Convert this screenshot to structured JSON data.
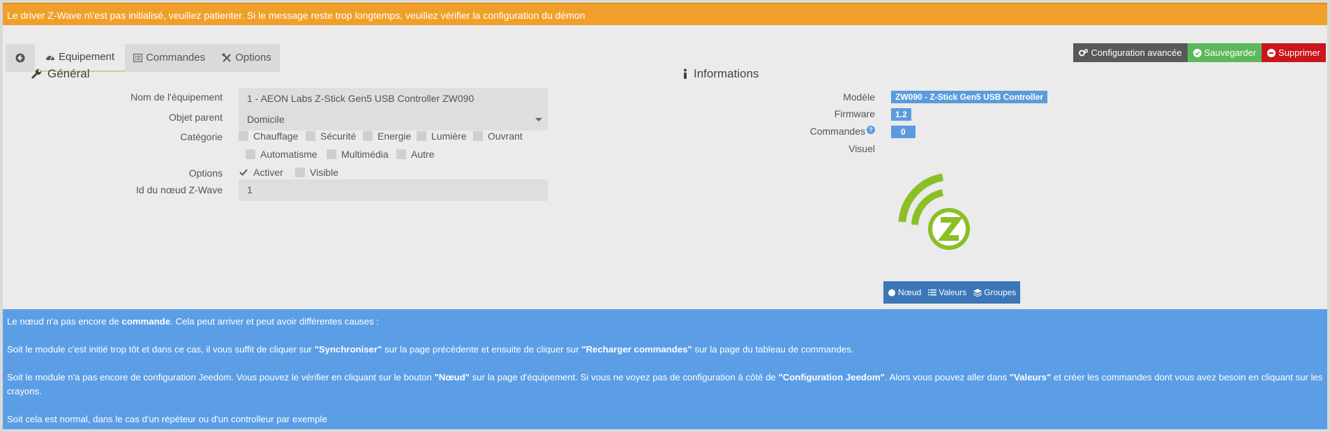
{
  "alert": {
    "text": "Le driver Z-Wave n\\'est pas initialisé, veuillez patienter. Si le message reste trop longtemps, veuillez vérifier la configuration du démon"
  },
  "tabs": [
    {
      "label": "Equipement"
    },
    {
      "label": "Commandes"
    },
    {
      "label": "Options"
    }
  ],
  "toolbar": {
    "advanced_label": "Configuration avancée",
    "save_label": "Sauvegarder",
    "delete_label": "Supprimer"
  },
  "general": {
    "title": "Général",
    "name_label": "Nom de l'équipement",
    "name_value": "1 - AEON Labs Z-Stick Gen5 USB Controller ZW090",
    "parent_label": "Objet parent",
    "parent_value": "Domicile",
    "category_label": "Catégorie",
    "categories": [
      "Chauffage",
      "Sécurité",
      "Energie",
      "Lumière",
      "Ouvrant",
      "Automatisme",
      "Multimédia",
      "Autre"
    ],
    "options_label": "Options",
    "option_activate": "Activer",
    "option_visible": "Visible",
    "node_id_label": "Id du nœud Z-Wave",
    "node_id_value": "1"
  },
  "informations": {
    "title": "Informations",
    "model_label": "Modèle",
    "model_value": "ZW090 - Z-Stick Gen5 USB Controller",
    "firmware_label": "Firmware",
    "firmware_value": "1.2",
    "commands_label": "Commandes",
    "commands_value": "0",
    "visual_label": "Visuel",
    "buttons": {
      "node": "Nœud",
      "values": "Valeurs",
      "groups": "Groupes"
    }
  },
  "info_box": {
    "p1_a": "Le nœud n'a pas encore de ",
    "p1_b": "commande",
    "p1_c": ". Cela peut arriver et peut avoir différentes causes :",
    "p2_a": "Soit le module c'est initié trop tôt et dans ce cas, il vous suffit de cliquer sur ",
    "p2_b": "\"Synchroniser\"",
    "p2_c": " sur la page précédente et ensuite de cliquer sur ",
    "p2_d": "\"Recharger commandes\"",
    "p2_e": " sur la page du tableau de commandes.",
    "p3_a": "Soit le module n'a pas encore de configuration Jeedom. Vous pouvez le vérifier en cliquant sur le bouton ",
    "p3_b": "\"Nœud\"",
    "p3_c": " sur la page d'équipement. Si vous ne voyez pas de configuration à côté de ",
    "p3_d": "\"Configuration Jeedom\"",
    "p3_e": ". Alors vous pouvez aller dans ",
    "p3_f": "\"Valeurs\"",
    "p3_g": " et créer les commandes dont vous avez besoin en cliquant sur les crayons.",
    "p4": "Soit cela est normal, dans le cas d'un répéteur ou d'un controlleur par exemple"
  },
  "colors": {
    "warning": "#f0a02a",
    "info": "#5b9ee6",
    "success": "#5cb85c",
    "danger": "#c9151b",
    "zwave": "#8cbf26"
  }
}
